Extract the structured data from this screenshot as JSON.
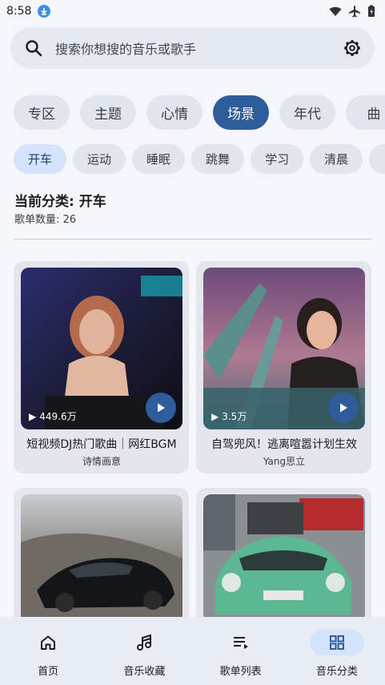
{
  "status_bar": {
    "time": "8:58"
  },
  "search": {
    "placeholder": "搜索你想搜的音乐或歌手"
  },
  "categories": [
    "专区",
    "主题",
    "心情",
    "场景",
    "年代",
    "曲"
  ],
  "active_category": "场景",
  "subcategories": [
    "开车",
    "运动",
    "睡眠",
    "跳舞",
    "学习",
    "清晨"
  ],
  "active_subcategory": "开车",
  "info": {
    "current_category": "当前分类: 开车",
    "playlist_count": "歌单数量: 26"
  },
  "playlists": [
    {
      "plays": "449.6万",
      "title": "短视频DJ热门歌曲｜网红BGM",
      "author": "诗情画意"
    },
    {
      "plays": "3.5万",
      "title": "自驾兜风！逃离喧嚣计划生效",
      "author": "Yang思立"
    },
    {
      "plays": "",
      "title": "",
      "author": ""
    },
    {
      "plays": "",
      "title": "",
      "author": ""
    }
  ],
  "bottom_nav": [
    {
      "label": "首页",
      "icon": "home-icon"
    },
    {
      "label": "音乐收藏",
      "icon": "music-note-icon"
    },
    {
      "label": "歌单列表",
      "icon": "playlist-icon"
    },
    {
      "label": "音乐分类",
      "icon": "grid-icon"
    }
  ],
  "active_nav": "音乐分类",
  "colors": {
    "accent": "#2f5c9a",
    "chip_selected": "#d3e3fb",
    "background": "#f4f6fb"
  }
}
